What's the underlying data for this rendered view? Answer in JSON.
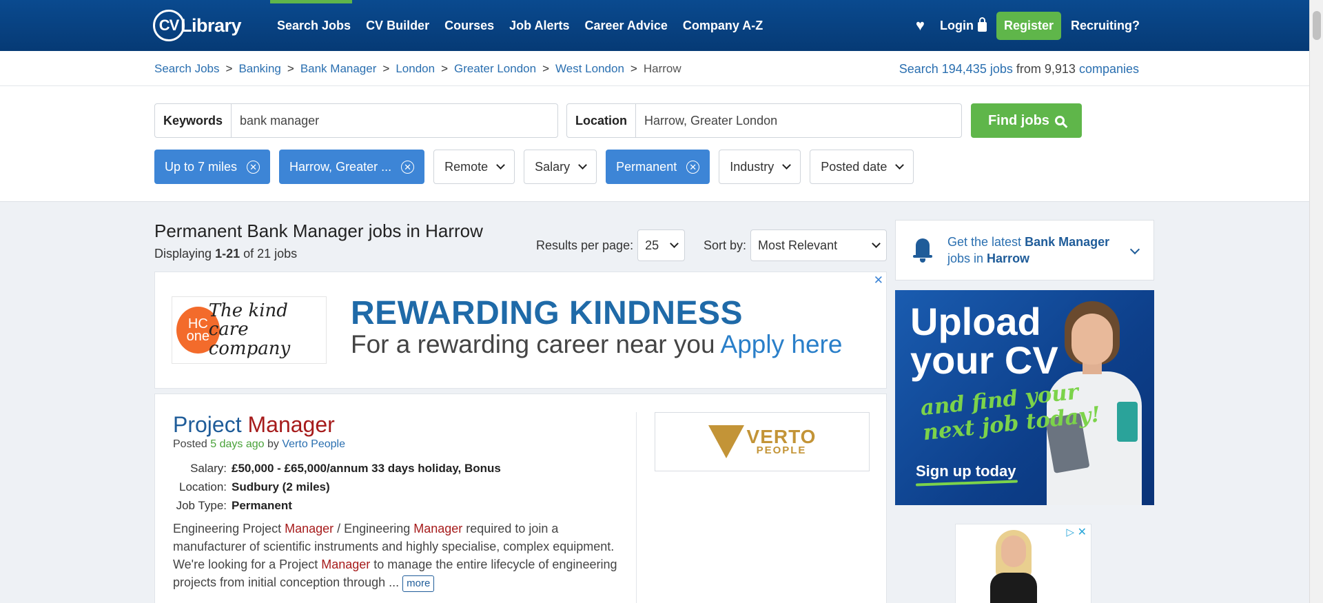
{
  "header": {
    "logo_cv": "CV",
    "logo_library": "Library",
    "nav": [
      "Search Jobs",
      "CV Builder",
      "Courses",
      "Job Alerts",
      "Career Advice",
      "Company A-Z"
    ],
    "login": "Login",
    "register": "Register",
    "recruiting": "Recruiting?"
  },
  "breadcrumb": {
    "items": [
      "Search Jobs",
      "Banking",
      "Bank Manager",
      "London",
      "Greater London",
      "West London"
    ],
    "current": "Harrow",
    "separator": ">"
  },
  "stats": {
    "prefix": "Search",
    "jobs": "194,435 jobs",
    "middle": "from",
    "companies_count": "9,913",
    "companies": "companies"
  },
  "search": {
    "keywords_label": "Keywords",
    "keywords_value": "bank manager",
    "location_label": "Location",
    "location_value": "Harrow, Greater London",
    "find_button": "Find jobs"
  },
  "filters": [
    {
      "label": "Up to 7 miles",
      "active": true
    },
    {
      "label": "Harrow, Greater ...",
      "active": true
    },
    {
      "label": "Remote",
      "active": false
    },
    {
      "label": "Salary",
      "active": false
    },
    {
      "label": "Permanent",
      "active": true
    },
    {
      "label": "Industry",
      "active": false
    },
    {
      "label": "Posted date",
      "active": false
    }
  ],
  "results": {
    "heading": "Permanent Bank Manager jobs in Harrow",
    "displaying_prefix": "Displaying",
    "displaying_range": "1-21",
    "displaying_suffix": "of 21 jobs",
    "per_page_label": "Results per page:",
    "per_page_value": "25",
    "sort_label": "Sort by:",
    "sort_value": "Most Relevant"
  },
  "ad_banner": {
    "logo_hc": "HC",
    "logo_one": "one",
    "logo_tag_1": "The kind",
    "logo_tag_2": "care company",
    "title": "REWARDING KINDNESS",
    "subtitle": "For a rewarding career near you",
    "cta": "Apply here",
    "close": "✕"
  },
  "job": {
    "title_plain": "Project",
    "title_highlight": "Manager",
    "posted_prefix": "Posted",
    "posted_when": "5 days ago",
    "posted_by": "by",
    "company": "Verto People",
    "salary_label": "Salary:",
    "salary": "£50,000 - £65,000/annum 33 days holiday, Bonus",
    "location_label": "Location:",
    "location": "Sudbury (2 miles)",
    "type_label": "Job Type:",
    "type": "Permanent",
    "desc_1": "Engineering Project ",
    "desc_2": "Manager",
    "desc_3": " / Engineering ",
    "desc_4": "Manager",
    "desc_5": " required to join a manufacturer of scientific instruments and highly specialise, complex equipment. We're looking for a Project ",
    "desc_6": "Manager",
    "desc_7": " to manage the entire lifecycle of engineering projects from initial conception through ... ",
    "more": "more",
    "logo_main": "VERTO",
    "logo_sub": "PEOPLE"
  },
  "sidebar": {
    "alert_prefix": "Get the latest",
    "alert_role": "Bank Manager",
    "alert_mid": "jobs in",
    "alert_place": "Harrow",
    "cv_ad_line1": "Upload",
    "cv_ad_line2": "your CV",
    "cv_ad_script1": "and find your",
    "cv_ad_script2": "next job today!",
    "cv_ad_cta": "Sign up today"
  },
  "colors": {
    "brand_blue": "#0a4a8f",
    "accent_green": "#5fb64a",
    "chip_blue": "#3d85d6",
    "keyword_highlight": "#a61b1b"
  }
}
